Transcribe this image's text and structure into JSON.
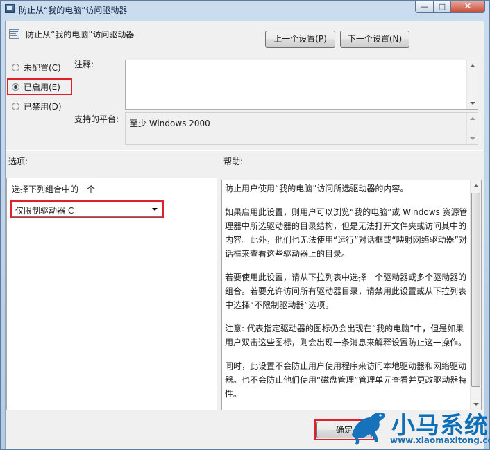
{
  "window": {
    "title": "防止从“我的电脑”访问驱动器",
    "controls": {
      "minimize": "—",
      "maximize": "□",
      "close": "✕"
    }
  },
  "header": {
    "setting_title": "防止从“我的电脑”访问驱动器",
    "prev_button": "上一个设置(P)",
    "next_button": "下一个设置(N)"
  },
  "state": {
    "options": [
      {
        "label": "未配置(C)",
        "checked": false
      },
      {
        "label": "已启用(E)",
        "checked": true
      },
      {
        "label": "已禁用(D)",
        "checked": false
      }
    ]
  },
  "comment": {
    "label": "注释:",
    "value": ""
  },
  "platform": {
    "label": "支持的平台:",
    "value": "至少 Windows 2000"
  },
  "options_section": {
    "label": "选项:",
    "select_prompt": "选择下列组合中的一个",
    "selected_value": "仅限制驱动器 C"
  },
  "help_section": {
    "label": "帮助:",
    "paragraphs": [
      "防止用户使用“我的电脑”访问所选驱动器的内容。",
      "如果启用此设置，则用户可以浏览“我的电脑”或 Windows 资源管理器中所选驱动器的目录结构，但是无法打开文件夹或访问其中的内容。此外，他们也无法使用“运行”对话框或“映射网络驱动器”对话框来查看这些驱动器上的目录。",
      "若要使用此设置，请从下拉列表中选择一个驱动器或多个驱动器的组合。若要允许访问所有驱动器目录，请禁用此设置或从下拉列表中选择“不限制驱动器”选项。",
      "注意: 代表指定驱动器的图标仍会出现在“我的电脑”中，但是如果用户双击这些图标，则会出现一条消息来解释设置防止这一操作。",
      "同时，此设置不会防止用户使用程序来访问本地驱动器和网络驱动器。也不会防止他们使用“磁盘管理”管理单元查看并更改驱动器特性。"
    ]
  },
  "footer": {
    "ok_button": "确定"
  },
  "watermark": {
    "title": "小马系统",
    "url": "www.xiaomaxitong.com"
  },
  "colors": {
    "highlight_border": "#e0202b",
    "watermark_blue": "#0d6fb8"
  }
}
